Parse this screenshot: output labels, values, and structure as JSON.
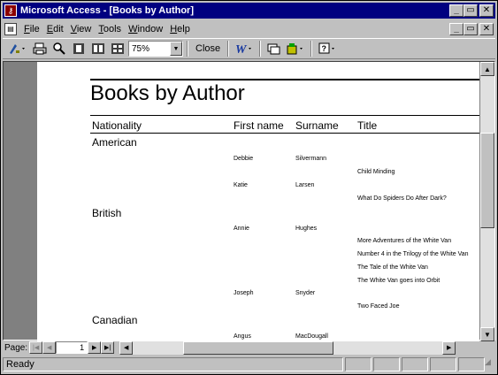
{
  "window": {
    "title": "Microsoft Access - [Books by Author]",
    "app_icon": "access-key-icon",
    "minimize": "_",
    "restore": "▭",
    "close": "✕"
  },
  "menu": {
    "items": [
      "File",
      "Edit",
      "View",
      "Tools",
      "Window",
      "Help"
    ]
  },
  "toolbar": {
    "zoom_value": "75%",
    "close_label": "Close",
    "icons": [
      "design-view-icon",
      "print-icon",
      "zoom-icon",
      "one-page-icon",
      "two-pages-icon",
      "multiple-pages-icon",
      "word-icon",
      "database-window-icon",
      "new-object-icon",
      "help-icon"
    ]
  },
  "report": {
    "title": "Books by Author",
    "headers": {
      "nationality": "Nationality",
      "first_name": "First name",
      "surname": "Surname",
      "title": "Title"
    },
    "groups": {
      "american": "American",
      "british": "British",
      "canadian": "Canadian"
    },
    "rows": {
      "debbie_first": "Debbie",
      "debbie_surname": "Silvermann",
      "debbie_book1": "Child Minding",
      "katie_first": "Katie",
      "katie_surname": "Larsen",
      "katie_book1": "What Do Spiders Do After Dark?",
      "annie_first": "Annie",
      "annie_surname": "Hughes",
      "annie_book1": "More Adventures of the White Van",
      "annie_book2": "Number 4 in the Trilogy of the White Van",
      "annie_book3": "The Tale of the White Van",
      "annie_book4": "The White Van goes into Orbit",
      "joseph_first": "Joseph",
      "joseph_surname": "Snyder",
      "joseph_book1": "Two Faced Joe",
      "angus_first": "Angus",
      "angus_surname": "MacDougall"
    }
  },
  "navigation": {
    "page_label": "Page:",
    "page_value": "1"
  },
  "status": {
    "text": "Ready"
  }
}
